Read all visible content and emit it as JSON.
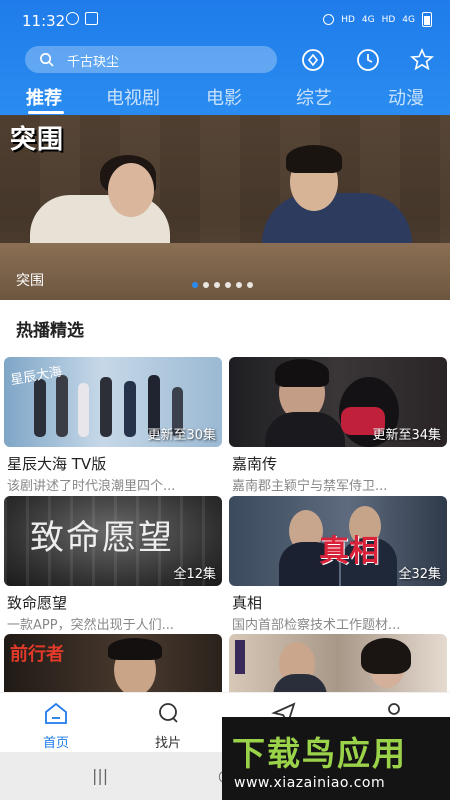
{
  "status_bar": {
    "time": "11:32",
    "right_labels": [
      "HD",
      "4G",
      "HD",
      "4G"
    ]
  },
  "search": {
    "placeholder": "千古玦尘"
  },
  "header_icons": [
    "vip-icon",
    "history-icon",
    "favorite-icon"
  ],
  "tabs": [
    {
      "label": "推荐",
      "active": true
    },
    {
      "label": "电视剧",
      "active": false
    },
    {
      "label": "电影",
      "active": false
    },
    {
      "label": "综艺",
      "active": false
    },
    {
      "label": "动漫",
      "active": false
    }
  ],
  "banner": {
    "logo": "突围",
    "caption": "突围",
    "dots": 6,
    "active_dot": 0
  },
  "section": {
    "title": "热播精选"
  },
  "cards": [
    {
      "title": "星辰大海 TV版",
      "badge": "更新至30集",
      "desc": "该剧讲述了时代浪潮里四个...",
      "poster_text": "星辰大海"
    },
    {
      "title": "嘉南传",
      "badge": "更新至34集",
      "desc": "嘉南郡主颖宁与禁军侍卫...",
      "poster_text": ""
    },
    {
      "title": "致命愿望",
      "badge": "全12集",
      "desc": "一款APP，突然出现于人们...",
      "poster_text": "致命愿望"
    },
    {
      "title": "真相",
      "badge": "全32集",
      "desc": "国内首部检察技术工作题材...",
      "poster_text": "真相"
    },
    {
      "title": "",
      "badge": "",
      "desc": "",
      "poster_text": "前行者"
    },
    {
      "title": "",
      "badge": "",
      "desc": "",
      "poster_text": ""
    }
  ],
  "bottom_nav": [
    {
      "label": "首页",
      "icon": "home-icon",
      "active": true
    },
    {
      "label": "找片",
      "icon": "search-icon",
      "active": false
    },
    {
      "label": "",
      "icon": "send-icon",
      "active": false
    },
    {
      "label": "",
      "icon": "profile-icon",
      "active": false
    }
  ],
  "watermark": {
    "title": "下载鸟应用",
    "url": "www.xiazainiao.com"
  },
  "colors": {
    "primary": "#1f7cea",
    "accent_green": "#9ad24a"
  }
}
